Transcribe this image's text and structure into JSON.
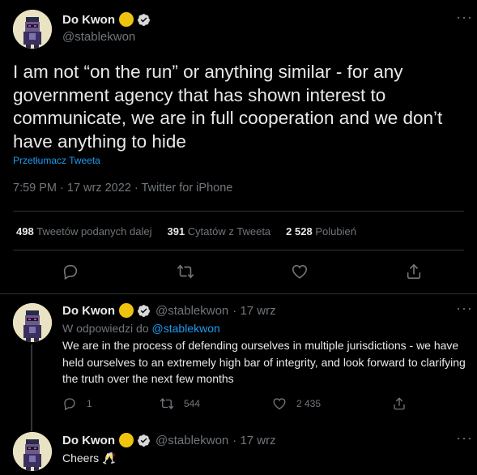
{
  "main_tweet": {
    "author": {
      "name": "Do Kwon",
      "handle": "@stablekwon"
    },
    "text": "I am not “on the run” or anything similar - for any government agency that has shown interest to communicate, we are in full cooperation and we don’t have anything to hide",
    "translate_label": "Przetłumacz Tweeta",
    "timestamp": "7:59 PM · 17 wrz 2022 · Twitter for iPhone",
    "stats": [
      {
        "count": "498",
        "label": "Tweetów podanych dalej"
      },
      {
        "count": "391",
        "label": "Cytatów z Tweeta"
      },
      {
        "count": "2 528",
        "label": "Polubień"
      }
    ],
    "actions": [
      "reply-icon",
      "retweet-icon",
      "like-icon",
      "share-icon"
    ]
  },
  "replies": [
    {
      "author": {
        "name": "Do Kwon",
        "handle": "@stablekwon",
        "time": "· 17 wrz"
      },
      "reply_to_label": "W odpowiedzi do",
      "reply_to_handle": "@stablekwon",
      "text": "We are in the process of defending ourselves in multiple jurisdictions - we have held ourselves to an extremely high bar of integrity, and look forward to clarifying the truth over the next few months",
      "counts": {
        "reply": "1",
        "retweet": "544",
        "like": "2 435"
      }
    },
    {
      "author": {
        "name": "Do Kwon",
        "handle": "@stablekwon",
        "time": "· 17 wrz"
      },
      "text": "Cheers 🥂"
    }
  ],
  "colors": {
    "background": "#000000",
    "text": "#e7e9ea",
    "muted": "#71767b",
    "link": "#1d9bf0",
    "divider": "#2f3336",
    "gold_badge": "#f0c30f",
    "verified_badge": "#1d9bf0"
  }
}
